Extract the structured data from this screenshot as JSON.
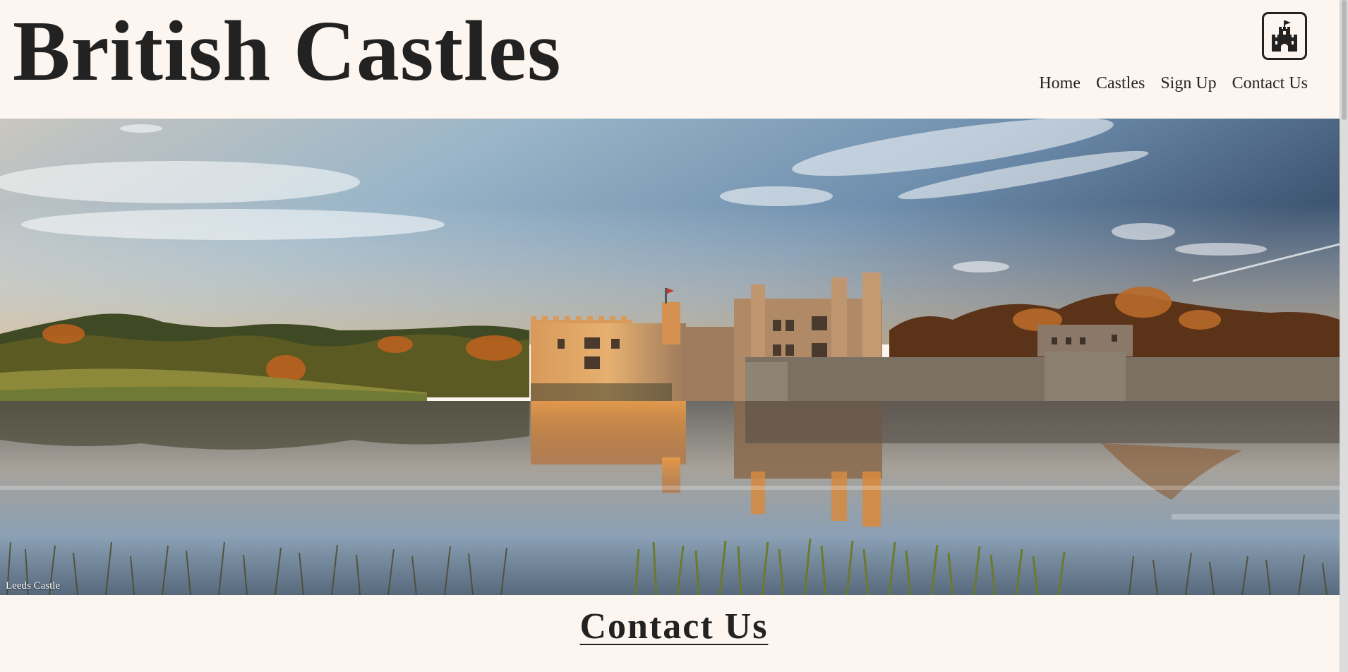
{
  "site": {
    "title": "British Castles"
  },
  "logo": {
    "icon": "castle-icon"
  },
  "nav": {
    "items": [
      {
        "label": "Home"
      },
      {
        "label": "Castles"
      },
      {
        "label": "Sign Up"
      },
      {
        "label": "Contact Us"
      }
    ]
  },
  "hero": {
    "caption": "Leeds Castle"
  },
  "main": {
    "heading": "Contact Us"
  },
  "colors": {
    "background": "#fdf5ef",
    "text": "#222222"
  }
}
